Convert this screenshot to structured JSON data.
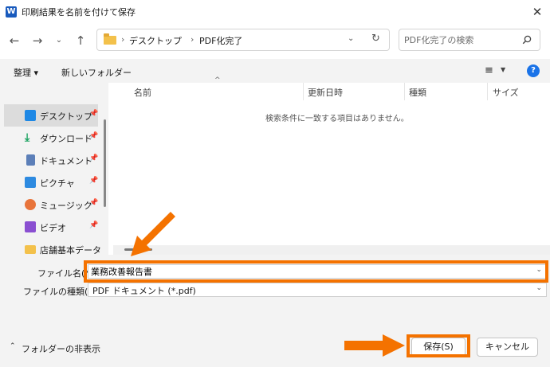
{
  "window": {
    "title": "印刷結果を名前を付けて保存",
    "app_icon_letter": "W"
  },
  "nav": {
    "breadcrumb": [
      "デスクトップ",
      "PDF化完了"
    ],
    "search_placeholder": "PDF化完了の検索"
  },
  "toolbar": {
    "organize_label": "整理 ▾",
    "new_folder_label": "新しいフォルダー"
  },
  "sidebar": {
    "items": [
      {
        "label": "デスクトップ",
        "icon": "desktop-icon",
        "color": "#1e88e5",
        "pinned": true,
        "selected": true
      },
      {
        "label": "ダウンロード",
        "icon": "download-icon",
        "color": "#1aa260",
        "pinned": true,
        "selected": false
      },
      {
        "label": "ドキュメント",
        "icon": "document-icon",
        "color": "#5c7fb8",
        "pinned": true,
        "selected": false
      },
      {
        "label": "ピクチャ",
        "icon": "pictures-icon",
        "color": "#2d8ae0",
        "pinned": true,
        "selected": false
      },
      {
        "label": "ミュージック",
        "icon": "music-icon",
        "color": "#e8743b",
        "pinned": true,
        "selected": false
      },
      {
        "label": "ビデオ",
        "icon": "video-icon",
        "color": "#8a4fd1",
        "pinned": true,
        "selected": false
      },
      {
        "label": "店舗基本データ",
        "icon": "folder-icon",
        "color": "#f3c14b",
        "pinned": false,
        "selected": false
      }
    ]
  },
  "list": {
    "columns": [
      "名前",
      "更新日時",
      "種類",
      "サイズ"
    ],
    "empty_message": "検索条件に一致する項目はありません。"
  },
  "form": {
    "filename_label": "ファイル名(N):",
    "filename_value": "業務改善報告書",
    "filetype_label": "ファイルの種類(T):",
    "filetype_value": "PDF ドキュメント (*.pdf)",
    "hide_folders_label": "フォルダーの非表示",
    "save_label": "保存(S)",
    "cancel_label": "キャンセル"
  },
  "colors": {
    "highlight": "#f47200",
    "accent": "#1a73e8"
  }
}
